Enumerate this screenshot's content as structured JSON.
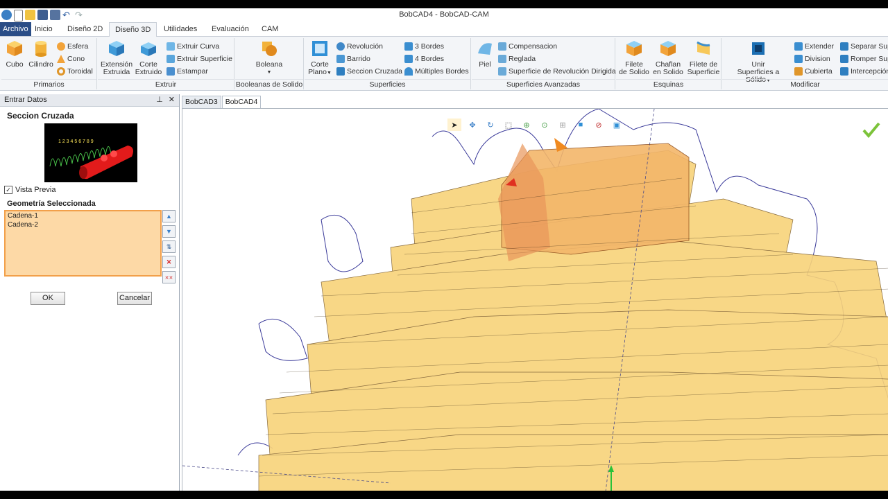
{
  "window": {
    "title": "BobCAD4 - BobCAD-CAM"
  },
  "tabs": [
    "Archivo",
    "Inicio",
    "Diseño 2D",
    "Diseño 3D",
    "Utilidades",
    "Evaluación",
    "CAM"
  ],
  "ribbon": {
    "primarios": {
      "label": "Primarios",
      "cubo": "Cubo",
      "cilindro": "Cilindro",
      "esfera": "Esfera",
      "cono": "Cono",
      "toroidal": "Toroidal"
    },
    "extruir": {
      "label": "Extruir",
      "extension_l1": "Extensión",
      "extension_l2": "Extruida",
      "corte_l1": "Corte",
      "corte_l2": "Extruido",
      "extruir_curva": "Extruir Curva",
      "extruir_superficie": "Extruir Superficie",
      "estampar": "Estampar"
    },
    "booleanas": {
      "label": "Booleanas de Solido",
      "boleana": "Boleana"
    },
    "superficies": {
      "label": "Superficies",
      "corte_plano_l1": "Corte",
      "corte_plano_l2": "Plano",
      "revolucion": "Revolución",
      "barrido": "Barrido",
      "seccion_cruzada": "Seccion Cruzada",
      "tres_bordes": "3 Bordes",
      "cuatro_bordes": "4 Bordes",
      "multiples_bordes": "Múltiples Bordes"
    },
    "avanzadas": {
      "label": "Superficies Avanzadas",
      "piel": "Piel",
      "compensacion": "Compensacion",
      "reglada": "Reglada",
      "superficie_revolucion": "Superficie de Revolución Dirigida"
    },
    "esquinas": {
      "label": "Esquinas",
      "filete_solido_l1": "Filete",
      "filete_solido_l2": "de Solido",
      "chaflan_l1": "Chaflan",
      "chaflan_l2": "en Solido",
      "filete_sup_l1": "Filete de",
      "filete_sup_l2": "Superficie"
    },
    "modificar": {
      "label": "Modificar",
      "unir_l1": "Unir",
      "unir_l2": "Superficies a Sólido",
      "extender": "Extender",
      "division": "Division",
      "cubierta": "Cubierta",
      "separar": "Separar Sup",
      "romper": "Romper Sup",
      "interseccion": "Intercepción"
    }
  },
  "panel": {
    "header": "Entrar Datos",
    "section_title": "Seccion Cruzada",
    "vista_previa": "Vista Previa",
    "geometria_label": "Geometría Seleccionada",
    "geometria_items": [
      "Cadena-1",
      "Cadena-2"
    ],
    "ok": "OK",
    "cancelar": "Cancelar"
  },
  "doc_tabs": [
    "BobCAD3",
    "BobCAD4"
  ],
  "colors": {
    "accent": "#2a4d86",
    "solid": "#f8d37a",
    "list_bg": "#fdd9a6"
  }
}
